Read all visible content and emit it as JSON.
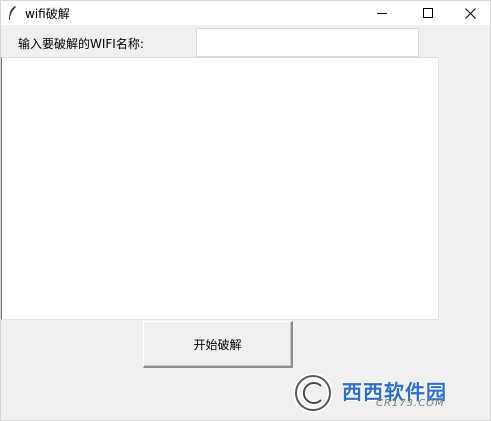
{
  "window": {
    "title": "wifi破解",
    "icon": "feather-icon"
  },
  "controls": {
    "minimize_icon": "minimize-icon",
    "maximize_icon": "maximize-icon",
    "close_icon": "close-icon"
  },
  "form": {
    "label": "输入要破解的WIFI名称:",
    "input_value": ""
  },
  "output": {
    "text": ""
  },
  "actions": {
    "start_label": "开始破解"
  },
  "watermark": {
    "brand": "西西软件园",
    "url": "CR173.COM",
    "logo_icon": "cr-logo-icon",
    "colors": {
      "blue": "#2f6fc9",
      "red": "#d83a2a"
    }
  }
}
